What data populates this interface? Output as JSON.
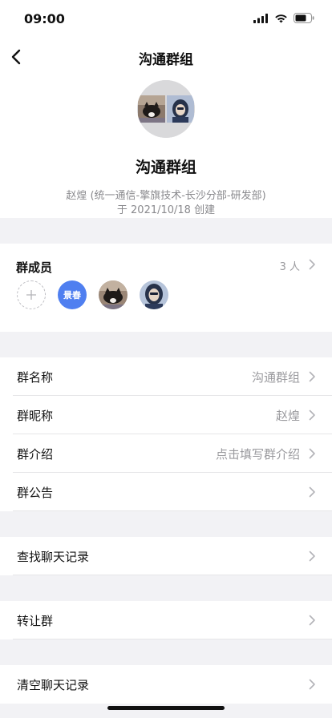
{
  "status_bar": {
    "time": "09:00"
  },
  "nav": {
    "title": "沟通群组"
  },
  "group": {
    "name": "沟通群组",
    "creator": "赵煌 (统一通信-擎旗技术-长沙分部-研发部)",
    "created": "于 2021/10/18 创建"
  },
  "members": {
    "title": "群成员",
    "count": "3 人",
    "badge_name": "景春",
    "badge_color": "#4f7ff0"
  },
  "settings": [
    {
      "label": "群名称",
      "value": "沟通群组"
    },
    {
      "label": "群昵称",
      "value": "赵煌"
    },
    {
      "label": "群介绍",
      "value": "点击填写群介绍"
    },
    {
      "label": "群公告",
      "value": ""
    }
  ],
  "actions": {
    "search_history": "查找聊天记录",
    "transfer_group": "转让群",
    "clear_history": "清空聊天记录"
  }
}
